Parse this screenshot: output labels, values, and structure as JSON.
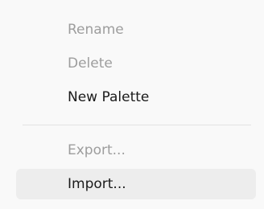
{
  "menu": {
    "items": [
      {
        "label": "Rename",
        "enabled": false
      },
      {
        "label": "Delete",
        "enabled": false
      },
      {
        "label": "New Palette",
        "enabled": true
      },
      {
        "label": "Export...",
        "enabled": false
      },
      {
        "label": "Import...",
        "enabled": true,
        "highlighted": true
      }
    ]
  },
  "colors": {
    "menu_background": "#f9f9f9",
    "text_enabled": "#1a1a1a",
    "text_disabled": "#9d9d9d",
    "hover_background": "#ededed",
    "separator": "#e2e2e2"
  }
}
